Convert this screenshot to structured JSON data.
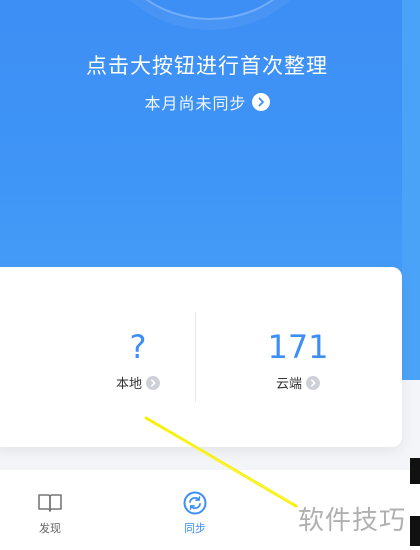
{
  "hero": {
    "title": "点击大按钮进行首次整理",
    "sync_status": "本月尚未同步"
  },
  "stats": {
    "local": {
      "value": "?",
      "label": "本地"
    },
    "cloud": {
      "value": "171",
      "label": "云端"
    }
  },
  "bottom_nav": {
    "tabs": [
      {
        "label": "发现",
        "icon": "book-icon",
        "active": false
      },
      {
        "label": "同步",
        "icon": "sync-icon",
        "active": true
      }
    ]
  },
  "watermark": "软件技巧",
  "colors": {
    "accent": "#3d8ef5",
    "annotation": "#f7f000"
  }
}
